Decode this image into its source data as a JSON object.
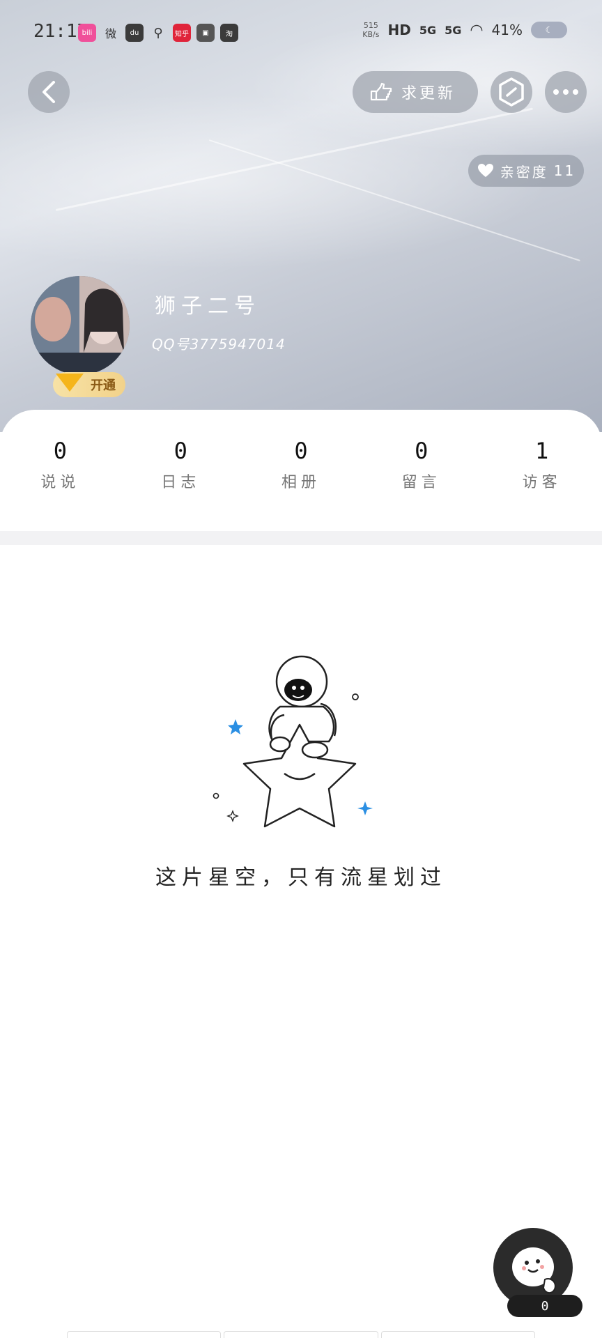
{
  "status_bar": {
    "time": "21:17",
    "app_icons": [
      "bilibili-icon",
      "weibo-icon",
      "du-icon",
      "maps-icon",
      "zhihu-icon",
      "game-icon",
      "taobao-icon"
    ],
    "app_icon_text": [
      "bili",
      "微",
      "du",
      "",
      "知乎",
      "",
      "淘"
    ],
    "net_speed": "515",
    "net_unit": "KB/s",
    "hd": "HD",
    "signal_1": "5G",
    "signal_2": "5G",
    "battery": "41%"
  },
  "header": {
    "update_button": "求更新"
  },
  "intimacy": {
    "label": "亲密度",
    "value": "11"
  },
  "profile": {
    "nickname": "狮子二号",
    "qq_number": "QQ号3775947014",
    "vip_label": "开通"
  },
  "stats": [
    {
      "value": "0",
      "label": "说说"
    },
    {
      "value": "0",
      "label": "日志"
    },
    {
      "value": "0",
      "label": "相册"
    },
    {
      "value": "0",
      "label": "留言"
    },
    {
      "value": "1",
      "label": "访客"
    }
  ],
  "empty_state": {
    "message": "这片星空，只有流星划过"
  },
  "fab": {
    "count": "0"
  },
  "colors": {
    "accent_star": "#2b8fe3",
    "vip_gold": "#f5b51a"
  }
}
